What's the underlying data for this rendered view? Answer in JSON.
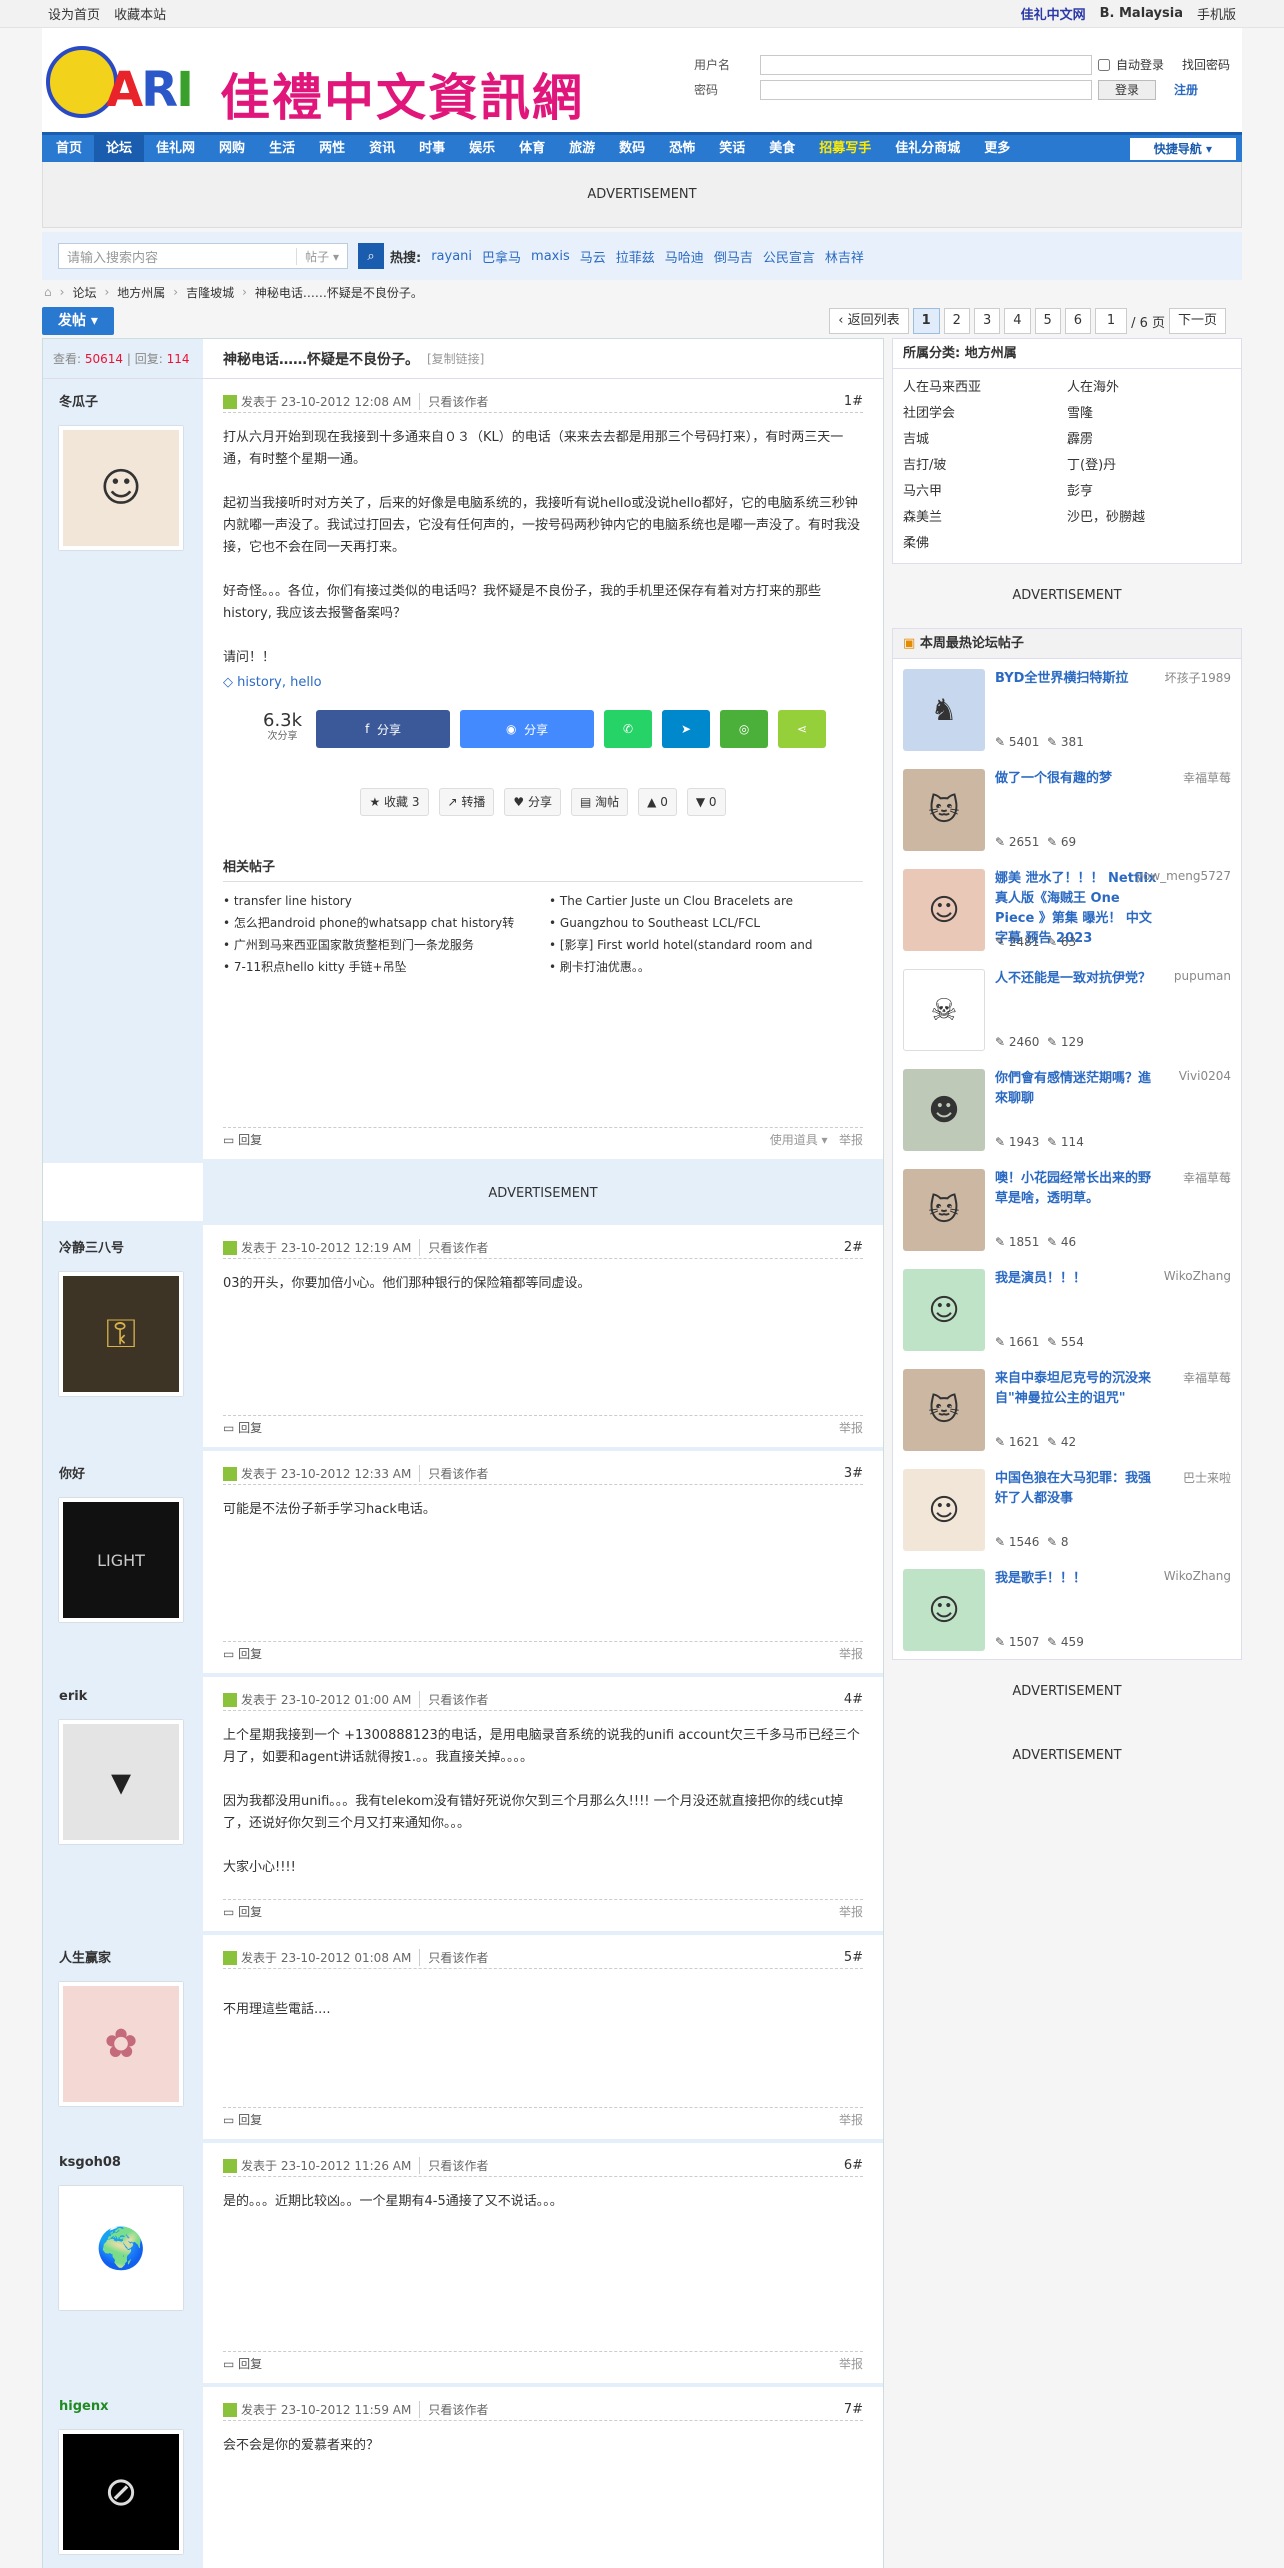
{
  "topbar": {
    "left": [
      "设为首页",
      "收藏本站"
    ],
    "brand": "佳礼中文网",
    "region": "B. Malaysia",
    "mobile": "手机版"
  },
  "logo": {
    "cn": "佳禮中文資訊網",
    "ari": "ARI"
  },
  "login": {
    "user_label": "用户名",
    "pass_label": "密码",
    "auto": "自动登录",
    "forgot": "找回密码",
    "submit": "登录",
    "register": "注册"
  },
  "nav": {
    "items": [
      "首页",
      "论坛",
      "佳礼网",
      "网购",
      "生活",
      "两性",
      "资讯",
      "时事",
      "娱乐",
      "体育",
      "旅游",
      "数码",
      "恐怖",
      "笑话",
      "美食",
      "招募写手",
      "佳礼分商城",
      "更多"
    ],
    "quick": "快捷导航"
  },
  "ad": "ADVERTISEMENT",
  "search": {
    "placeholder": "请输入搜索内容",
    "type": "帖子",
    "hot_label": "热搜:",
    "hot": [
      "rayani",
      "巴拿马",
      "maxis",
      "马云",
      "拉菲兹",
      "马哈迪",
      "倒马吉",
      "公民宣言",
      "林吉祥"
    ]
  },
  "crumb": [
    "论坛",
    "地方州属",
    "吉隆坡城",
    "神秘电话……怀疑是不良份子。"
  ],
  "postbtn": "发帖",
  "pager": {
    "back": "返回列表",
    "pages": [
      "1",
      "2",
      "3",
      "4",
      "5",
      "6"
    ],
    "input": "1",
    "total": "/ 6 页",
    "next": "下一页"
  },
  "thread": {
    "views_label": "查看:",
    "views": "50614",
    "replies_label": "回复:",
    "replies": "114",
    "title": "神秘电话……怀疑是不良份子。",
    "copy": "[复制链接]"
  },
  "posts": [
    {
      "author": "冬瓜子",
      "time": "发表于 23-10-2012 12:08 AM",
      "only": "只看该作者",
      "floor": "1#",
      "body": "打从六月开始到现在我接到十多通来自０３（KL）的电话（来来去去都是用那三个号码打来），有时两三天一通，有时整个星期一通。\n\n起初当我接听时对方关了，后来的好像是电脑系统的，我接听有说hello或没说hello都好，它的电脑系统三秒钟内就嘟一声没了。我试过打回去，它没有任何声的，一按号码两秒钟内它的电脑系统也是嘟一声没了。有时我没接，它也不会在同一天再打来。\n\n好奇怪。。。各位，你们有接过类似的电话吗？我怀疑是不良份子，我的手机里还保存有着对方打来的那些history, 我应该去报警备案吗？\n\n请问！！",
      "tags": "history, hello",
      "reply": "回复",
      "tools": "使用道具",
      "report": "举报"
    },
    {
      "author": "冷静三八号",
      "time": "发表于 23-10-2012 12:19 AM",
      "only": "只看该作者",
      "floor": "2#",
      "body": "03的开头，你要加倍小心。他们那种银行的保险箱都等同虚设。",
      "reply": "回复",
      "report": "举报"
    },
    {
      "author": "你好",
      "time": "发表于 23-10-2012 12:33 AM",
      "only": "只看该作者",
      "floor": "3#",
      "body": "可能是不法份子新手学习hack电话。",
      "reply": "回复",
      "report": "举报"
    },
    {
      "author": "erik",
      "time": "发表于 23-10-2012 01:00 AM",
      "only": "只看该作者",
      "floor": "4#",
      "body": "上个星期我接到一个 +1300888123的电话，是用电脑录音系统的说我的unifi account欠三千多马币已经三个月了，如要和agent讲话就得按1.。。我直接关掉。。。。\n\n因为我都没用unifi。。。我有telekom没有错好死说你欠到三个月那么久!!!! 一个月没还就直接把你的线cut掉了，还说好你欠到三个月又打来通知你。。。\n\n大家小心!!!!",
      "reply": "回复",
      "report": "举报"
    },
    {
      "author": "人生赢家",
      "time": "发表于 23-10-2012 01:08 AM",
      "only": "只看该作者",
      "floor": "5#",
      "body": "不用理這些電話....",
      "reply": "回复",
      "report": "举报"
    },
    {
      "author": "ksgoh08",
      "time": "发表于 23-10-2012 11:26 AM",
      "only": "只看该作者",
      "floor": "6#",
      "body": "是的。。。近期比较凶。。一个星期有4-5通接了又不说话。。。",
      "reply": "回复",
      "report": "举报"
    },
    {
      "author": "higenx",
      "time": "发表于 23-10-2012 11:59 AM",
      "only": "只看该作者",
      "floor": "7#",
      "body": "会不会是你的爱慕者来的？",
      "reply": "回复",
      "report": "举报"
    }
  ],
  "share": {
    "count": "6.3k",
    "count_label": "次分享",
    "fb": "分享",
    "msg": "分享"
  },
  "acts": [
    "收藏 3",
    "转播",
    "分享",
    "淘帖",
    "0",
    "0"
  ],
  "related": {
    "title": "相关帖子",
    "items": [
      "• transfer line history",
      "• The Cartier Juste un Clou Bracelets are",
      "• 怎么把android phone的whatsapp chat history转",
      "• Guangzhou to Southeast LCL/FCL",
      "• 广州到马来西亚国家散货整柜到门一条龙服务",
      "• [影享] First world hotel(standard room and",
      "• 7-11积点hello kitty 手链+吊坠",
      "• 刷卡打油优惠。。"
    ]
  },
  "side": {
    "cat_title": "所属分类: 地方州属",
    "cats": [
      "人在马来西亚",
      "人在海外",
      "社团学会",
      "雪隆",
      "吉城",
      "霹雳",
      "吉打/玻",
      "丁(登)丹",
      "马六甲",
      "彭亨",
      "森美兰",
      "沙巴，砂朥越",
      "柔佛"
    ],
    "hot_title": "本周最热论坛帖子",
    "hot": [
      {
        "t": "BYD全世界横扫特斯拉",
        "u": "坏孩子1989",
        "n": "5401",
        "r": "381"
      },
      {
        "t": "做了一个很有趣的梦",
        "u": "幸福草莓",
        "n": "2651",
        "r": "69"
      },
      {
        "t": "娜美 泄水了！！！ Netflix 真人版《海贼王 One Piece 》第集 曝光！ 中文字幕 预告 2023",
        "u": "yow_meng5727",
        "n": "2481",
        "r": "63"
      },
      {
        "t": "人不还能是一致对抗伊党？",
        "u": "pupuman",
        "n": "2460",
        "r": "129"
      },
      {
        "t": "你們會有感情迷茫期嗎？進來聊聊",
        "u": "Vivi0204",
        "n": "1943",
        "r": "114"
      },
      {
        "t": "噢！小花园经常长出来的野草是啥，透明草。",
        "u": "幸福草莓",
        "n": "1851",
        "r": "46"
      },
      {
        "t": "我是演员！！！",
        "u": "WikoZhang",
        "n": "1661",
        "r": "554"
      },
      {
        "t": "来自中泰坦尼克号的沉没来自\"神曼拉公主的诅咒\"",
        "u": "幸福草莓",
        "n": "1621",
        "r": "42"
      },
      {
        "t": "中国色狼在大马犯罪：我强奸了人都没事",
        "u": "巴士来啦",
        "n": "1546",
        "r": "8"
      },
      {
        "t": "我是歌手！！！",
        "u": "WikoZhang",
        "n": "1507",
        "r": "459"
      }
    ]
  }
}
